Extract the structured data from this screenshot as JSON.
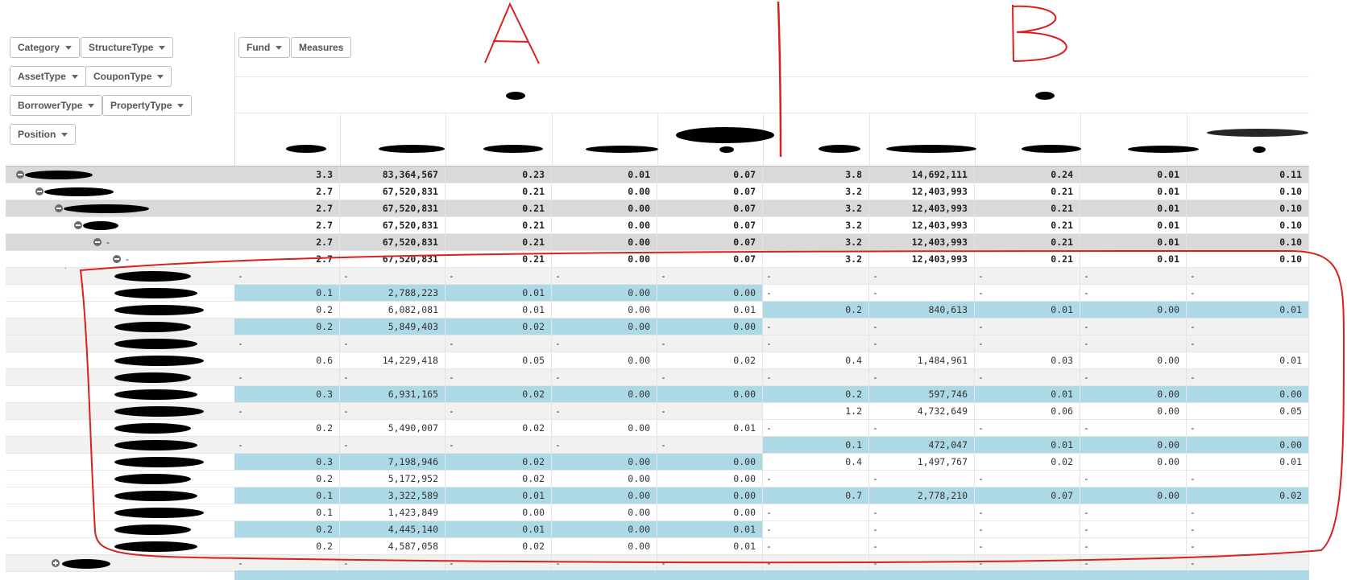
{
  "dimensions": {
    "row1": [
      "Category",
      "StructureType"
    ],
    "row2": [
      "AssetType",
      "CouponType"
    ],
    "row3": [
      "BorrowerType",
      "PropertyType"
    ],
    "row4": [
      "Position"
    ]
  },
  "column_dims": [
    "Fund",
    "Measures"
  ],
  "annotations": {
    "a": "A",
    "b": "B"
  },
  "dash": "-",
  "icons": {
    "expand": "minus-circle-icon",
    "collapse": "plus-circle-icon",
    "caret": "caret-down-icon"
  },
  "colors": {
    "highlight": "#add8e6",
    "total_row": "#d9d9d9",
    "annotation": "#d92020"
  },
  "table": {
    "rows": [
      {
        "type": "total",
        "label": "",
        "a": [
          "3.3",
          "83,364,567",
          "0.23",
          "0.01",
          "0.07"
        ],
        "b": [
          "3.8",
          "14,692,111",
          "0.24",
          "0.01",
          "0.11"
        ]
      },
      {
        "type": "total-white",
        "label": "",
        "a": [
          "2.7",
          "67,520,831",
          "0.21",
          "0.00",
          "0.07"
        ],
        "b": [
          "3.2",
          "12,403,993",
          "0.21",
          "0.01",
          "0.10"
        ]
      },
      {
        "type": "total",
        "label": "",
        "a": [
          "2.7",
          "67,520,831",
          "0.21",
          "0.00",
          "0.07"
        ],
        "b": [
          "3.2",
          "12,403,993",
          "0.21",
          "0.01",
          "0.10"
        ]
      },
      {
        "type": "total-white",
        "label": "",
        "a": [
          "2.7",
          "67,520,831",
          "0.21",
          "0.00",
          "0.07"
        ],
        "b": [
          "3.2",
          "12,403,993",
          "0.21",
          "0.01",
          "0.10"
        ]
      },
      {
        "type": "total",
        "label": "-",
        "a": [
          "2.7",
          "67,520,831",
          "0.21",
          "0.00",
          "0.07"
        ],
        "b": [
          "3.2",
          "12,403,993",
          "0.21",
          "0.01",
          "0.10"
        ]
      },
      {
        "type": "total-white",
        "label": "-",
        "a": [
          "2.7",
          "67,520,831",
          "0.21",
          "0.00",
          "0.07"
        ],
        "b": [
          "3.2",
          "12,403,993",
          "0.21",
          "0.01",
          "0.10"
        ]
      },
      {
        "type": "grey",
        "a": null,
        "b": null
      },
      {
        "type": "white",
        "a": [
          "0.1",
          "2,788,223",
          "0.01",
          "0.00",
          "0.00"
        ],
        "ahl": true,
        "b": null
      },
      {
        "type": "white",
        "a": [
          "0.2",
          "6,082,081",
          "0.01",
          "0.00",
          "0.01"
        ],
        "b": [
          "0.2",
          "840,613",
          "0.01",
          "0.00",
          "0.01"
        ],
        "bhl": true
      },
      {
        "type": "grey",
        "a": [
          "0.2",
          "5,849,403",
          "0.02",
          "0.00",
          "0.00"
        ],
        "ahl": true,
        "b": null
      },
      {
        "type": "grey",
        "a": null,
        "b": null
      },
      {
        "type": "white",
        "a": [
          "0.6",
          "14,229,418",
          "0.05",
          "0.00",
          "0.02"
        ],
        "b": [
          "0.4",
          "1,484,961",
          "0.03",
          "0.00",
          "0.01"
        ]
      },
      {
        "type": "grey",
        "a": null,
        "b": null
      },
      {
        "type": "white",
        "a": [
          "0.3",
          "6,931,165",
          "0.02",
          "0.00",
          "0.00"
        ],
        "ahl": true,
        "b": [
          "0.2",
          "597,746",
          "0.01",
          "0.00",
          "0.00"
        ],
        "bhl": true
      },
      {
        "type": "grey",
        "a": null,
        "b": [
          "1.2",
          "4,732,649",
          "0.06",
          "0.00",
          "0.05"
        ],
        "bwhite": true
      },
      {
        "type": "white",
        "a": [
          "0.2",
          "5,490,007",
          "0.02",
          "0.00",
          "0.01"
        ],
        "b": null
      },
      {
        "type": "grey",
        "a": null,
        "b": [
          "0.1",
          "472,047",
          "0.01",
          "0.00",
          "0.00"
        ],
        "bhl": true
      },
      {
        "type": "white",
        "a": [
          "0.3",
          "7,198,946",
          "0.02",
          "0.00",
          "0.00"
        ],
        "ahl": true,
        "b": [
          "0.4",
          "1,497,767",
          "0.02",
          "0.00",
          "0.01"
        ]
      },
      {
        "type": "white",
        "a": [
          "0.2",
          "5,172,952",
          "0.02",
          "0.00",
          "0.00"
        ],
        "b": null
      },
      {
        "type": "white",
        "a": [
          "0.1",
          "3,322,589",
          "0.01",
          "0.00",
          "0.00"
        ],
        "ahl": true,
        "b": [
          "0.7",
          "2,778,210",
          "0.07",
          "0.00",
          "0.02"
        ],
        "bhl": true
      },
      {
        "type": "white",
        "a": [
          "0.1",
          "1,423,849",
          "0.00",
          "0.00",
          "0.00"
        ],
        "b": null
      },
      {
        "type": "white",
        "a": [
          "0.2",
          "4,445,140",
          "0.01",
          "0.00",
          "0.01"
        ],
        "ahl": true,
        "b": null
      },
      {
        "type": "white",
        "a": [
          "0.2",
          "4,587,058",
          "0.02",
          "0.00",
          "0.01"
        ],
        "b": null
      },
      {
        "type": "grey",
        "a": null,
        "b": null
      }
    ]
  }
}
